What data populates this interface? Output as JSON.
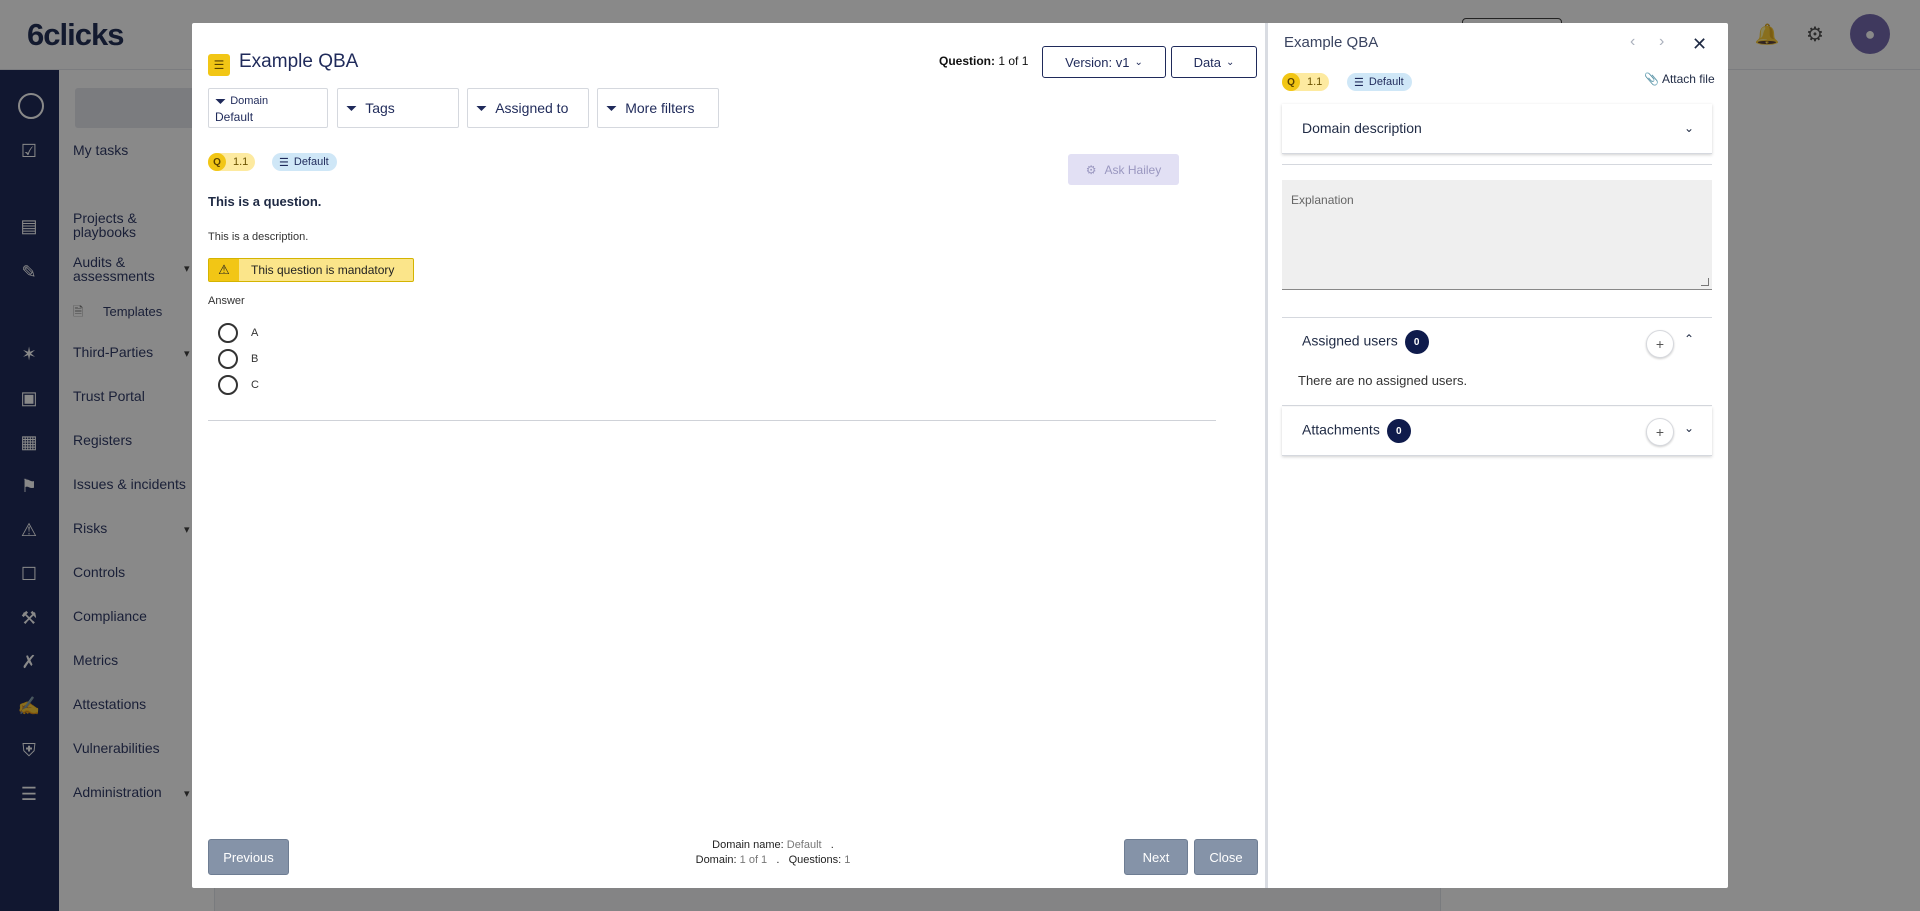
{
  "app": {
    "logo": "6clicks"
  },
  "nav": {
    "items": [
      {
        "label": "My tasks"
      },
      {
        "label": "Projects & playbooks"
      },
      {
        "label": "Audits & assessments"
      },
      {
        "label": "Templates"
      },
      {
        "label": "Third-Parties"
      },
      {
        "label": "Trust Portal"
      },
      {
        "label": "Registers"
      },
      {
        "label": "Issues & incidents"
      },
      {
        "label": "Risks"
      },
      {
        "label": "Controls"
      },
      {
        "label": "Compliance"
      },
      {
        "label": "Metrics"
      },
      {
        "label": "Attestations"
      },
      {
        "label": "Vulnerabilities"
      },
      {
        "label": "Administration"
      }
    ]
  },
  "modal": {
    "title": "Example QBA",
    "question_label": "Question:",
    "question_value": "1 of 1",
    "version_label": "Version: v1",
    "data_label": "Data",
    "filters": {
      "domain_label": "Domain",
      "domain_value": "Default",
      "tags": "Tags",
      "assigned_to": "Assigned to",
      "more_filters": "More filters"
    },
    "chip_q": "Q",
    "chip_number": "1.1",
    "chip_domain": "Default",
    "ask_hailey": "Ask Hailey",
    "question_text": "This is a question.",
    "description": "This is a description.",
    "mandatory": "This question is mandatory",
    "answer_label": "Answer",
    "options": [
      "A",
      "B",
      "C"
    ],
    "footer": {
      "previous": "Previous",
      "next": "Next",
      "close": "Close",
      "domain_name_label": "Domain name:",
      "domain_name_value": "Default",
      "domain_label": "Domain:",
      "domain_value": "1 of 1",
      "questions_label": "Questions:",
      "questions_value": "1"
    }
  },
  "detail": {
    "title": "Example QBA",
    "attach_file": "Attach file",
    "chip_q": "Q",
    "chip_number": "1.1",
    "chip_domain": "Default",
    "domain_description": "Domain description",
    "explanation_placeholder": "Explanation",
    "assigned_users": "Assigned users",
    "assigned_count": "0",
    "no_assigned": "There are no assigned users.",
    "attachments": "Attachments",
    "attachments_count": "0"
  },
  "colors": {
    "navy": "#0f1b4c",
    "accent_yellow": "#f2c615",
    "chip_blue": "#cfe7f7",
    "footer_btn": "#8593a8"
  }
}
